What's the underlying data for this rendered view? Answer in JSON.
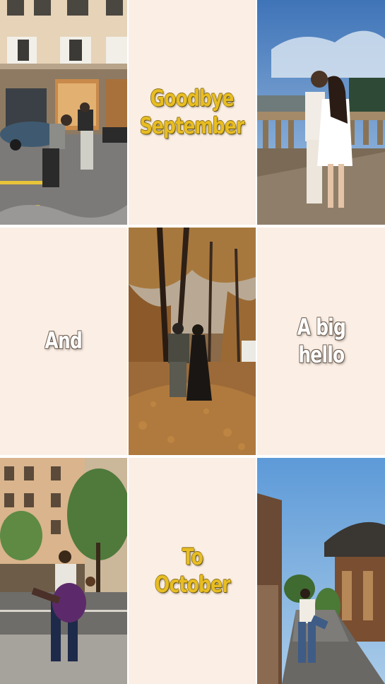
{
  "captions": {
    "top_center": {
      "line1": "Goodbye",
      "line2": "September"
    },
    "middle_left": {
      "line1": "And"
    },
    "middle_right": {
      "line1": "A big",
      "line2": "hello"
    },
    "bottom_center": {
      "line1": "To",
      "line2": "October"
    }
  },
  "colors": {
    "cream_background": "#fbeee4",
    "yellow_text": "#e7bd23",
    "white_text": "#ffffff"
  },
  "photos": {
    "top_left": "street-dancers-photo",
    "top_right": "couple-on-bridge-photo",
    "center": "autumn-park-walk-photo",
    "bottom_left": "man-carrying-woman-photo",
    "bottom_right": "hanok-village-couple-photo"
  }
}
